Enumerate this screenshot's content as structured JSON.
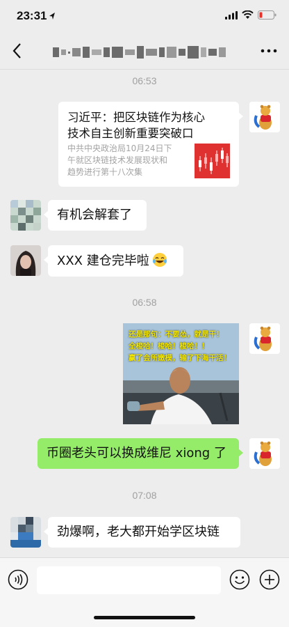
{
  "status_bar": {
    "time": "23:31"
  },
  "chat": {
    "messages": [
      {
        "type": "timestamp",
        "text": "06:53"
      },
      {
        "type": "link_card",
        "side": "right",
        "title": "习近平：把区块链作为核心\n技术自主创新重要突破口",
        "description": "中共中央政治局10月24日下\n午就区块链技术发展现状和\n趋势进行第十八次集"
      },
      {
        "type": "text",
        "side": "left",
        "text": "有机会解套了"
      },
      {
        "type": "text",
        "side": "left",
        "text": "XXX 建仓完毕啦",
        "emoji": "laughing-tears-emoji"
      },
      {
        "type": "timestamp",
        "text": "06:58"
      },
      {
        "type": "image",
        "side": "right",
        "caption": "还是那句：不要怂，就是干！\n全梭哈！梭哈！梭哈！！\n赢了会所嫩模，输了下海干活！"
      },
      {
        "type": "text",
        "side": "right",
        "text": "币圈老头可以换成维尼 xiong 了"
      },
      {
        "type": "timestamp",
        "text": "07:08"
      },
      {
        "type": "text",
        "side": "left",
        "text": "劲爆啊，老大都开始学区块链"
      }
    ]
  },
  "colors": {
    "background": "#ededed",
    "bubble_self": "#95ec69",
    "bubble_other": "#ffffff",
    "timestamp": "#a0a0a0"
  }
}
